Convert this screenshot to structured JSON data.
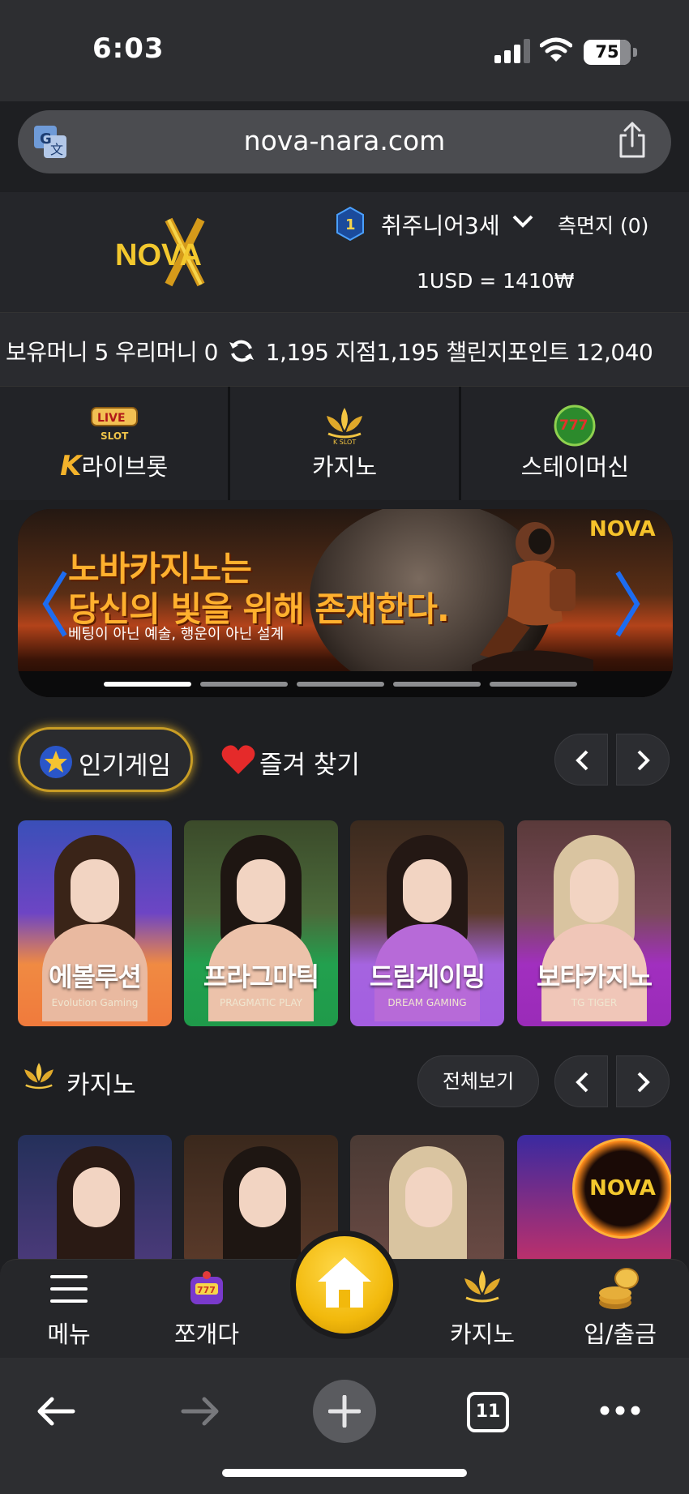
{
  "status_bar": {
    "time": "6:03",
    "battery": "75"
  },
  "browser": {
    "url": "nova-nara.com",
    "tab_count": "11"
  },
  "header": {
    "logo": "NOVA",
    "level": "1",
    "username": "취주니어3세",
    "notes": "측면지 (0)",
    "exchange_rate": "1USD = 1410₩"
  },
  "balance": {
    "text_1": "보유머니 5 우리머니 0",
    "text_2": "1,195 지점1,195 챌린지포인트 12,040"
  },
  "categories": [
    {
      "label": "라이브롯",
      "prefix": "K",
      "icon": "live-slot-icon",
      "icon_text": "LIVE"
    },
    {
      "label": "카지노",
      "icon": "k-slot-lotus-icon",
      "icon_text": "K SLOT"
    },
    {
      "label": "스테이머신",
      "icon": "777-slots-icon",
      "icon_text": "777"
    }
  ],
  "banner": {
    "line1": "노바카지노는",
    "line2": "당신의 빛을 위해 존재한다.",
    "sub": "베팅이 아닌 예술, 행운이 아닌 설계",
    "logo": "NOVA",
    "slides": 5,
    "active_slide": 1
  },
  "tabs": {
    "popular": "인기게임",
    "favorites": "즐겨 찾기"
  },
  "popular_games": [
    {
      "name": "에볼루션",
      "brand": "Evolution Gaming",
      "bg": "#f07a3c"
    },
    {
      "name": "프라그마틱",
      "brand": "PRAGMATIC PLAY",
      "bg": "#1f9a4a"
    },
    {
      "name": "드림게이밍",
      "brand": "DREAM GAMING",
      "bg": "#a45ee0"
    },
    {
      "name": "보타카지노",
      "brand": "TG TIGER",
      "bg": "#9a2bb8"
    }
  ],
  "casino_section": {
    "title": "카지노",
    "view_all": "전체보기",
    "badge": "NOVA"
  },
  "bottom_nav": [
    {
      "label": "메뉴",
      "icon": "menu-icon"
    },
    {
      "label": "쪼개다",
      "icon": "slot-machine-icon"
    },
    {
      "label": "",
      "icon": "home-icon"
    },
    {
      "label": "카지노",
      "icon": "k-slot-lotus-icon"
    },
    {
      "label": "입/출금",
      "icon": "coins-icon"
    }
  ]
}
